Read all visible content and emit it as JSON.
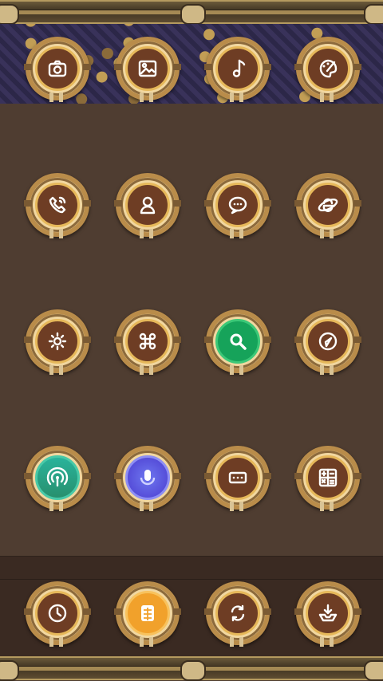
{
  "colors": {
    "background": "#4f3d31",
    "dock": "#3a2a22",
    "frame_gold": "#c29e55",
    "core_brown": "#6e3d24",
    "green": "#16a35a",
    "teal": "#29b39b",
    "blue": "#5a55e0",
    "orange": "#f1a12b"
  },
  "rows": [
    {
      "icons": [
        {
          "name": "camera-app",
          "icon": "camera-icon",
          "core": "brown"
        },
        {
          "name": "gallery-app",
          "icon": "picture-icon",
          "core": "brown"
        },
        {
          "name": "music-app",
          "icon": "music-note-icon",
          "core": "brown"
        },
        {
          "name": "theme-app",
          "icon": "palette-icon",
          "core": "brown"
        }
      ]
    },
    {
      "icons": [
        {
          "name": "phone-app",
          "icon": "phone-icon",
          "core": "brown"
        },
        {
          "name": "contacts-app",
          "icon": "person-icon",
          "core": "brown"
        },
        {
          "name": "messages-app",
          "icon": "chat-bubble-icon",
          "core": "brown"
        },
        {
          "name": "browser-app",
          "icon": "internet-explorer-icon",
          "core": "brown"
        }
      ]
    },
    {
      "icons": [
        {
          "name": "settings-app",
          "icon": "gear-icon",
          "core": "brown"
        },
        {
          "name": "apps-app",
          "icon": "command-key-icon",
          "core": "brown"
        },
        {
          "name": "search-app",
          "icon": "magnifier-icon",
          "core": "green"
        },
        {
          "name": "compass-app",
          "icon": "compass-icon",
          "core": "brown"
        }
      ]
    },
    {
      "icons": [
        {
          "name": "hotspot-app",
          "icon": "wireless-signal-icon",
          "core": "teal"
        },
        {
          "name": "voice-app",
          "icon": "microphone-icon",
          "core": "blue"
        },
        {
          "name": "dialer-app",
          "icon": "keypad-icon",
          "core": "brown"
        },
        {
          "name": "calculator-app",
          "icon": "calculator-icon",
          "core": "brown"
        }
      ]
    }
  ],
  "dock": [
    {
      "name": "clock-app",
      "icon": "clock-icon",
      "core": "brown"
    },
    {
      "name": "sim-app",
      "icon": "sim-card-icon",
      "core": "orange"
    },
    {
      "name": "sync-app",
      "icon": "sync-icon",
      "core": "brown"
    },
    {
      "name": "download-app",
      "icon": "download-tray-icon",
      "core": "brown"
    }
  ]
}
